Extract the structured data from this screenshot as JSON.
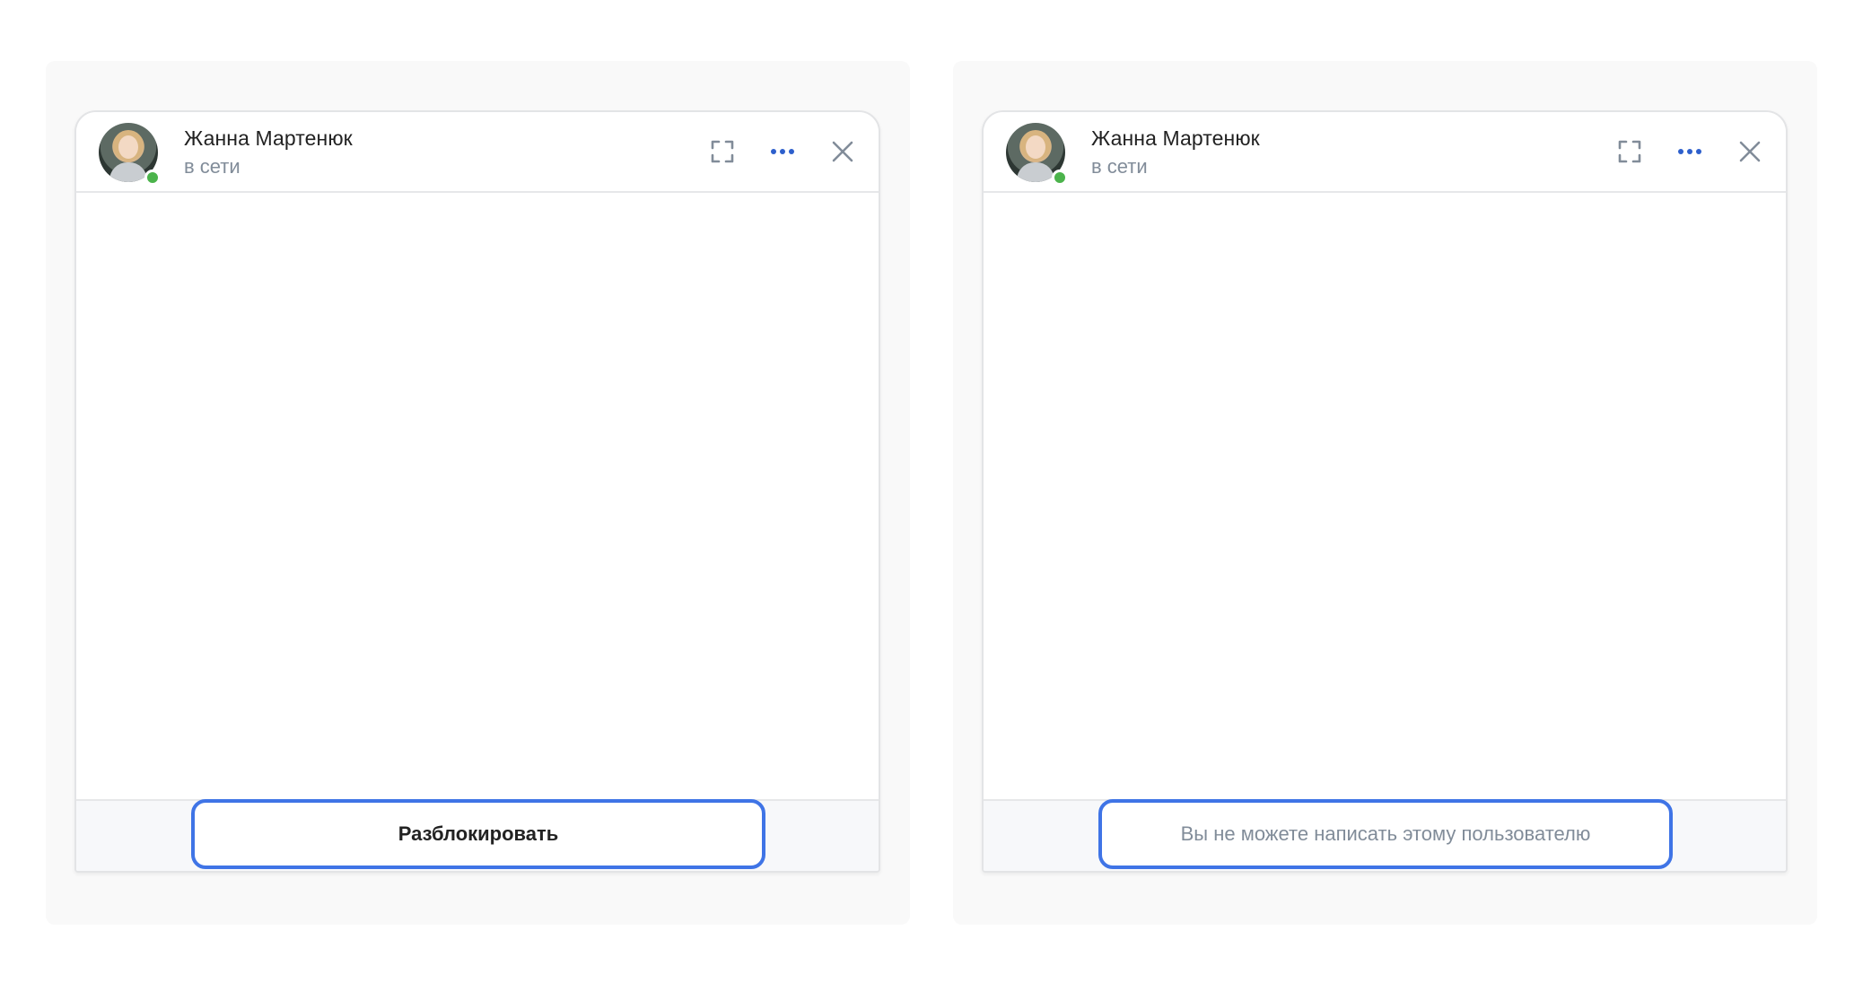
{
  "panels": [
    {
      "contact": {
        "name": "Жанна Мартенюк",
        "status": "в сети"
      },
      "footer": {
        "type": "button",
        "label": "Разблокировать"
      }
    },
    {
      "contact": {
        "name": "Жанна Мартенюк",
        "status": "в сети"
      },
      "footer": {
        "type": "notice",
        "label": "Вы не можете написать этому пользователю"
      }
    }
  ],
  "icons": {
    "expand": "expand-icon",
    "more": "more-dots-icon",
    "close": "close-icon"
  },
  "colors": {
    "accent": "#3f74e6",
    "online": "#4bb34b",
    "secondary_text": "#818c99",
    "more_dots": "#2d5fcc"
  }
}
